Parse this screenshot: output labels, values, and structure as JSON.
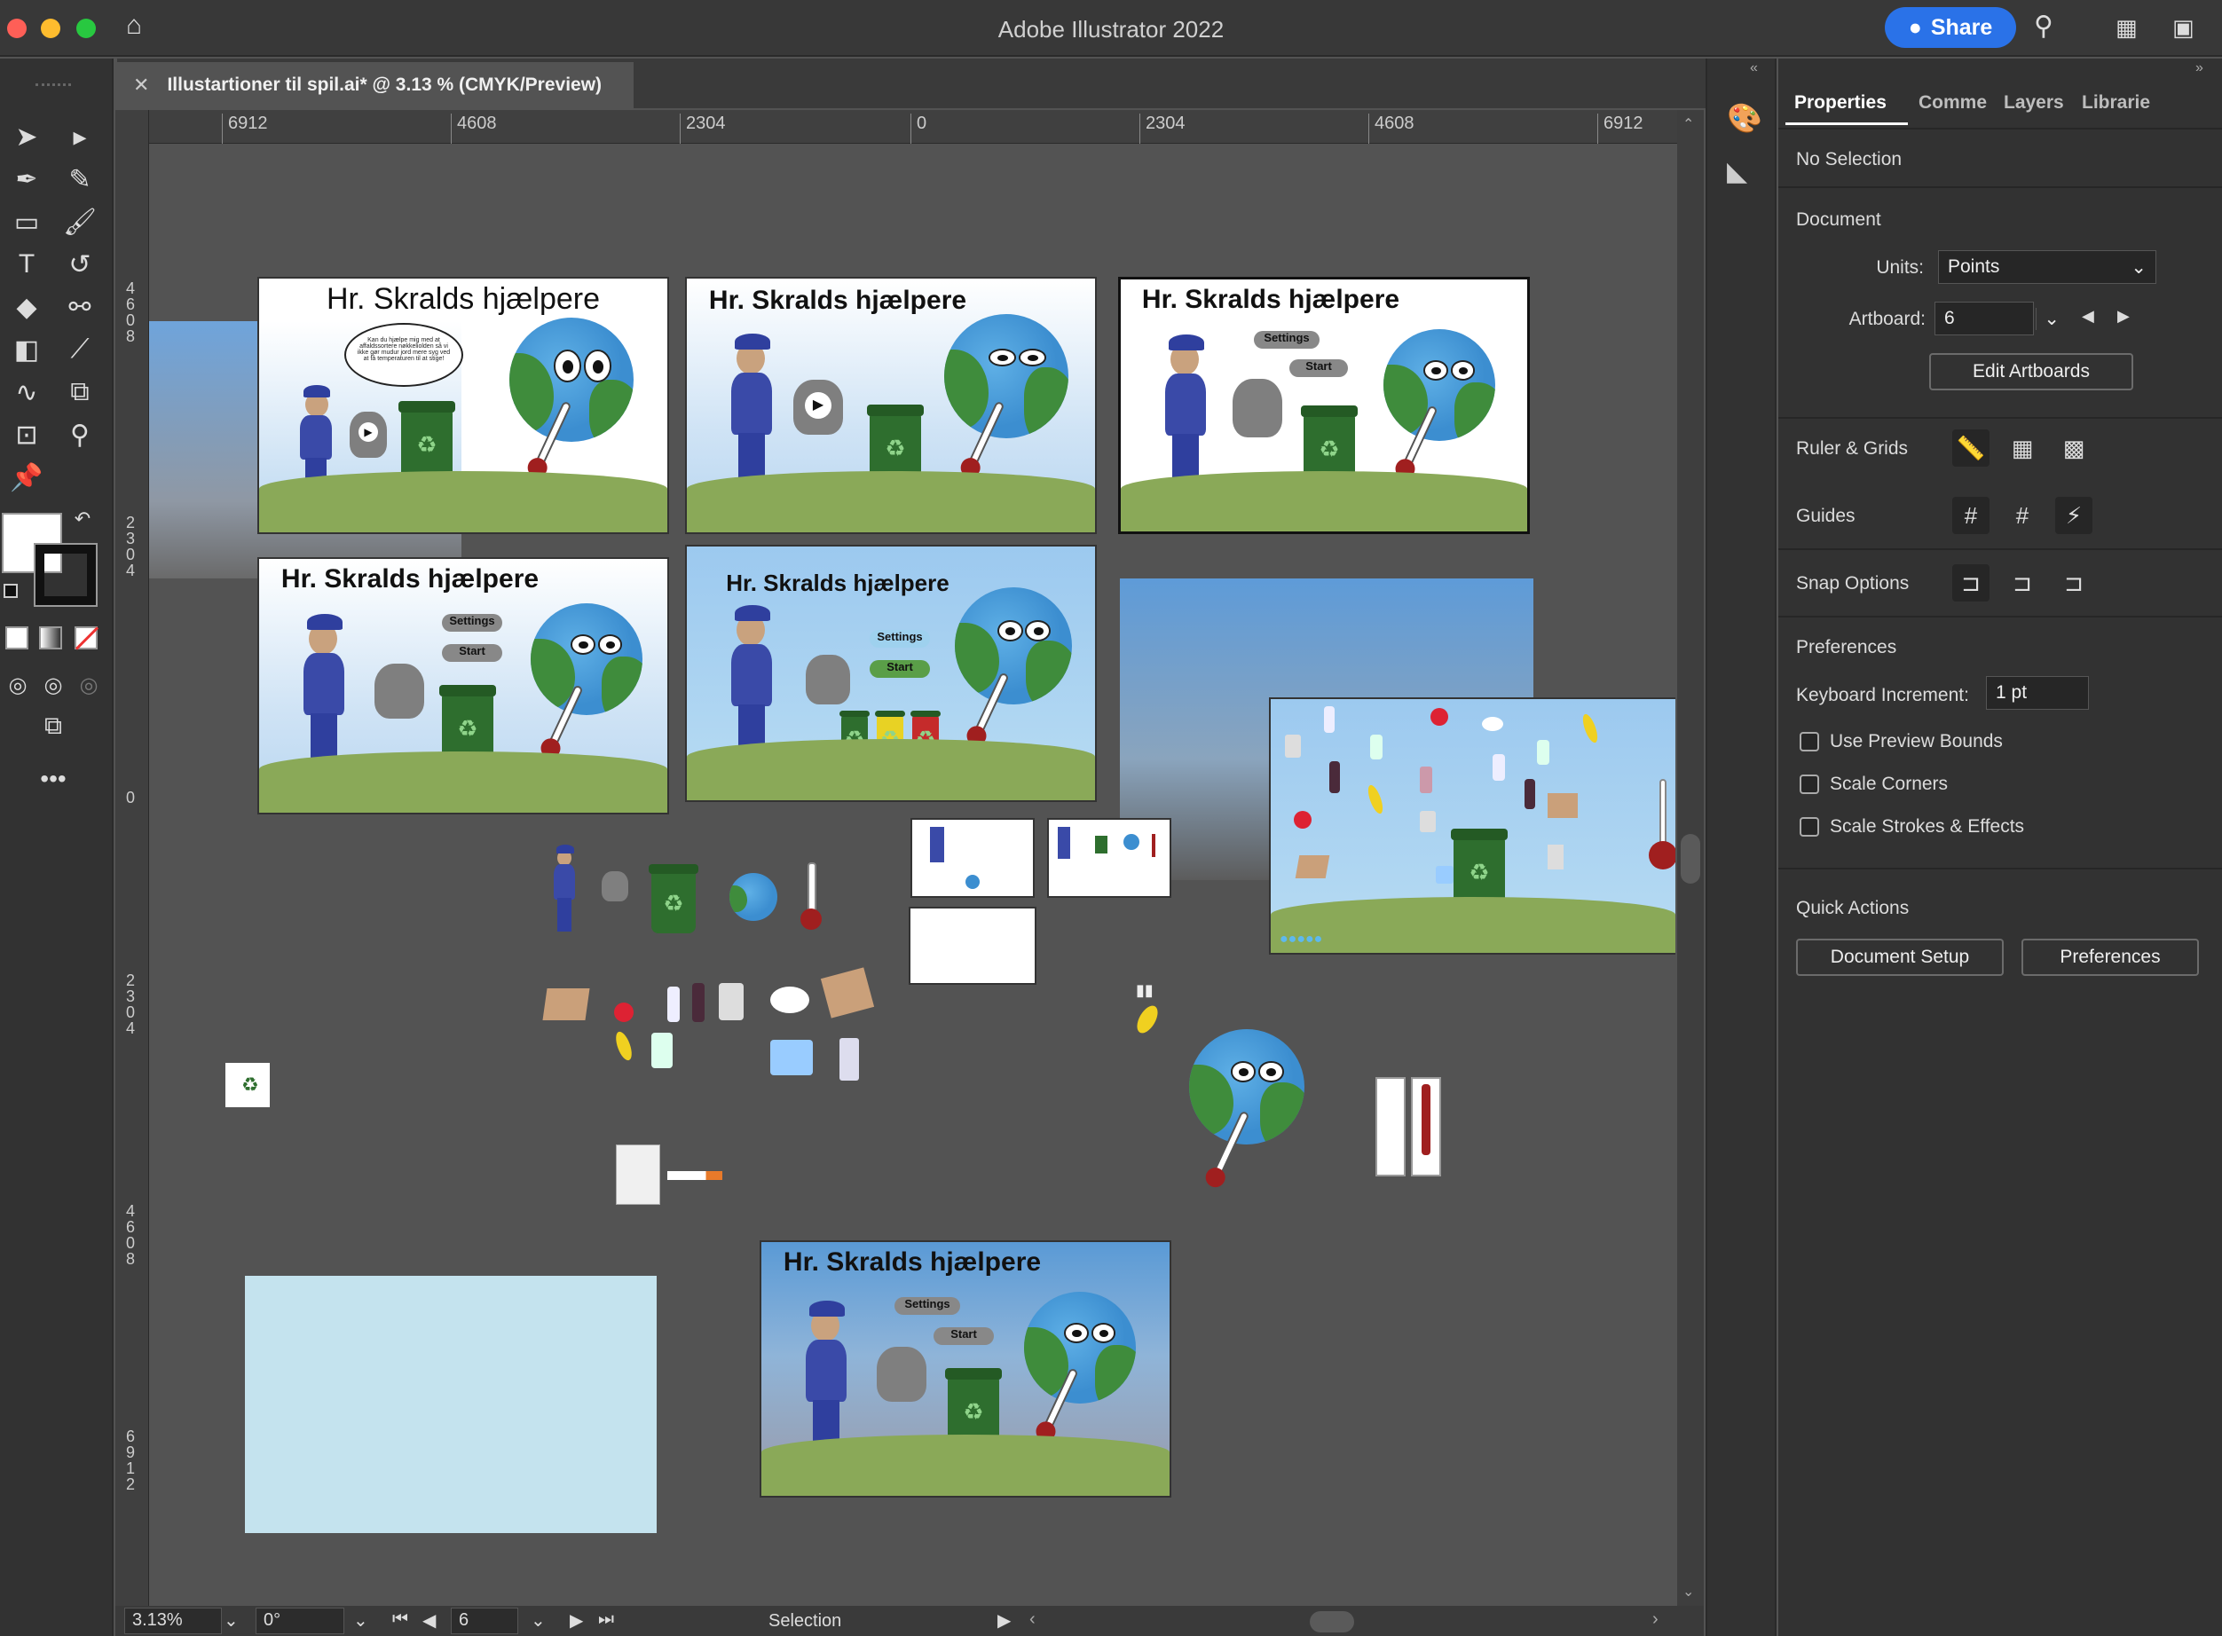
{
  "app": {
    "title": "Adobe Illustrator 2022",
    "share_label": "Share"
  },
  "document": {
    "tab_title": "Illustartioner til spil.ai* @ 3.13 % (CMYK/Preview)"
  },
  "rulers": {
    "top": [
      "6912",
      "4608",
      "2304",
      "0",
      "2304",
      "4608",
      "6912"
    ],
    "left": [
      "4608",
      "2304",
      "0",
      "2304",
      "4608",
      "6912"
    ]
  },
  "artboards": {
    "title": "Hr. Skralds hjælpere",
    "settings_label": "Settings",
    "start_label": "Start",
    "bubble_text": "Kan du hjælpe mig med at affaldssortere nøkkeliolden så vi ikke gør mudur jord mere syg ved at få temperaturen til at stige!"
  },
  "status": {
    "zoom": "3.13%",
    "rotation": "0°",
    "artboard_num": "6",
    "mode": "Selection"
  },
  "panel": {
    "tabs": [
      "Properties",
      "Comme",
      "Layers",
      "Librarie"
    ],
    "selection": "No Selection",
    "document_header": "Document",
    "units_label": "Units:",
    "units_value": "Points",
    "artboard_label": "Artboard:",
    "artboard_value": "6",
    "edit_artboards": "Edit Artboards",
    "ruler_grids": "Ruler & Grids",
    "guides": "Guides",
    "snap_options": "Snap Options",
    "preferences_header": "Preferences",
    "keyboard_increment_label": "Keyboard Increment:",
    "keyboard_increment_value": "1 pt",
    "checkboxes": [
      "Use Preview Bounds",
      "Scale Corners",
      "Scale Strokes & Effects"
    ],
    "quick_actions": "Quick Actions",
    "document_setup": "Document Setup",
    "preferences_btn": "Preferences"
  },
  "colors": {
    "accent": "#2a72e8",
    "sky": "#9cc9ef",
    "grass": "#8aa958",
    "bin": "#2e6e2e"
  }
}
